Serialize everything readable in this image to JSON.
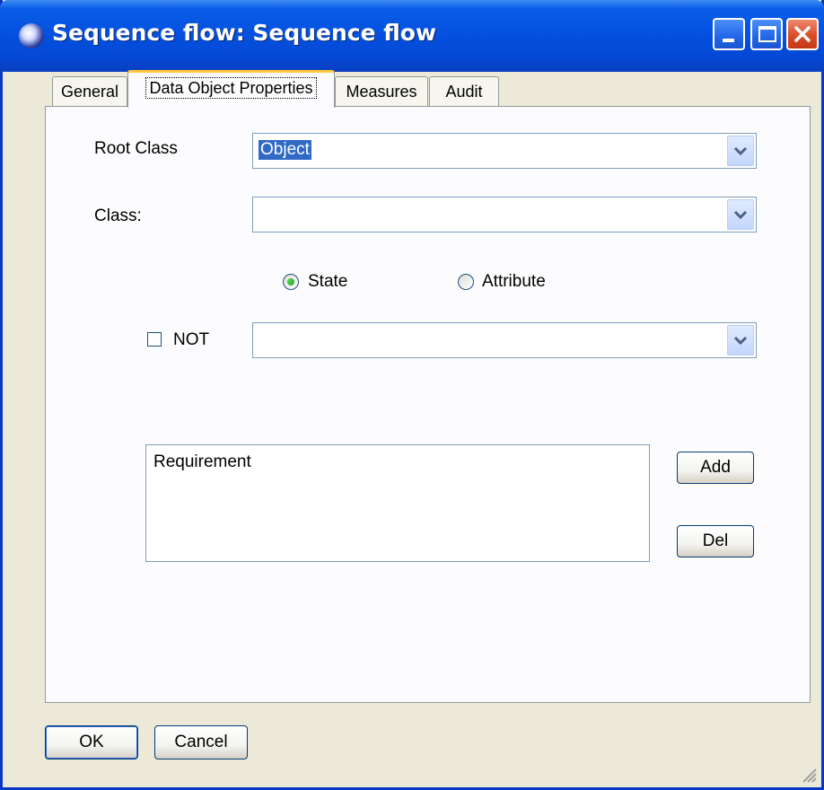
{
  "window": {
    "title": "Sequence flow: Sequence flow"
  },
  "tabs": [
    {
      "label": "General"
    },
    {
      "label": "Data Object Properties"
    },
    {
      "label": "Measures"
    },
    {
      "label": "Audit"
    }
  ],
  "form": {
    "root_class_label": "Root Class",
    "root_class_value": "Object",
    "class_label": "Class:",
    "class_value": "",
    "radio_state_label": "State",
    "radio_attribute_label": "Attribute",
    "not_label": "NOT",
    "not_value": ""
  },
  "list": {
    "items": [
      "Requirement"
    ]
  },
  "buttons": {
    "add": "Add",
    "del": "Del",
    "ok": "OK",
    "cancel": "Cancel"
  },
  "icons": {
    "app": "app-icon",
    "minimize": "minimize-icon",
    "maximize": "maximize-icon",
    "close": "close-icon",
    "dropdown": "chevron-down-icon",
    "grip": "resize-grip-icon"
  },
  "state": {
    "active_tab": "Data Object Properties",
    "selected_radio": "State",
    "not_checked": false
  },
  "colors": {
    "titlebar": "#0551e0",
    "dialog_bg": "#ece9d8",
    "selection": "#316ac5",
    "active_tab_accent": "#ffc83c",
    "close_button": "#d94c28"
  }
}
